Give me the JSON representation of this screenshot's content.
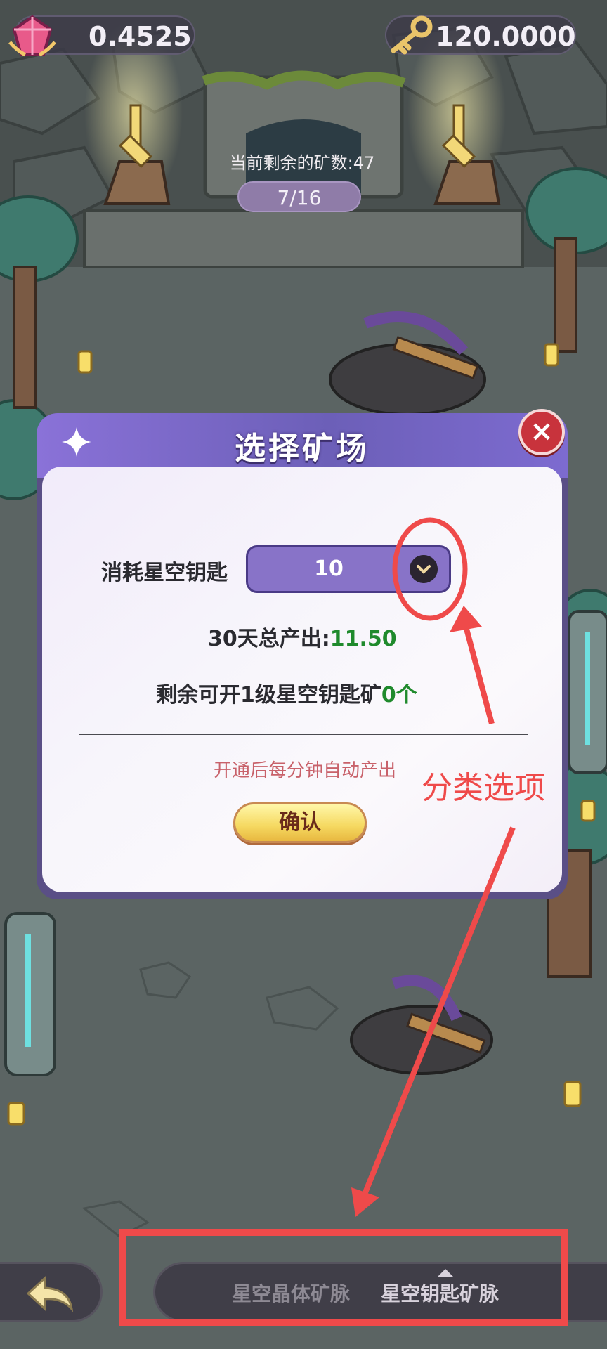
{
  "hud": {
    "gem_balance": "0.4525",
    "key_balance": "120.0000"
  },
  "mine_status": {
    "remaining_text": "当前剩余的矿数:47",
    "progress": "7/16"
  },
  "modal": {
    "title": "选择矿场",
    "close_label": "×",
    "consume_label": "消耗星空钥匙",
    "select_value": "10",
    "output_label": "30天总产出:",
    "output_value": "11.50",
    "remaining_open_label": "剩余可开1级星空钥匙矿",
    "remaining_open_value": "0个",
    "hint": "开通后每分钟自动产出",
    "confirm_label": "确认"
  },
  "annotation": {
    "text": "分类选项",
    "color": "#ef4a4a"
  },
  "bottom_nav": {
    "tabs": [
      {
        "label": "星空晶体矿脉",
        "active": false
      },
      {
        "label": "星空钥匙矿脉",
        "active": true
      }
    ]
  },
  "icons": {
    "gem": "gem-icon",
    "key": "key-icon",
    "back": "back-arrow-icon",
    "close": "close-icon",
    "dropdown": "chevron-down-icon"
  }
}
